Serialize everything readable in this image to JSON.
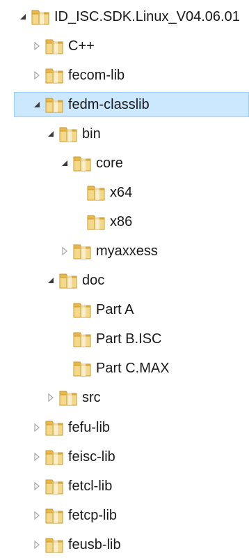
{
  "tree": {
    "items": [
      {
        "label": "ID_ISC.SDK.Linux_V04.06.01",
        "state": "expanded",
        "selected": false
      },
      {
        "label": "C++",
        "state": "collapsed",
        "selected": false
      },
      {
        "label": "fecom-lib",
        "state": "collapsed",
        "selected": false
      },
      {
        "label": "fedm-classlib",
        "state": "expanded",
        "selected": true
      },
      {
        "label": "bin",
        "state": "expanded",
        "selected": false
      },
      {
        "label": "core",
        "state": "expanded",
        "selected": false
      },
      {
        "label": "x64",
        "state": "leaf",
        "selected": false
      },
      {
        "label": "x86",
        "state": "leaf",
        "selected": false
      },
      {
        "label": "myaxxess",
        "state": "collapsed",
        "selected": false
      },
      {
        "label": "doc",
        "state": "expanded",
        "selected": false
      },
      {
        "label": "Part A",
        "state": "leaf",
        "selected": false
      },
      {
        "label": "Part B.ISC",
        "state": "leaf",
        "selected": false
      },
      {
        "label": "Part C.MAX",
        "state": "leaf",
        "selected": false
      },
      {
        "label": "src",
        "state": "collapsed",
        "selected": false
      },
      {
        "label": "fefu-lib",
        "state": "collapsed",
        "selected": false
      },
      {
        "label": "feisc-lib",
        "state": "collapsed",
        "selected": false
      },
      {
        "label": "fetcl-lib",
        "state": "collapsed",
        "selected": false
      },
      {
        "label": "fetcp-lib",
        "state": "collapsed",
        "selected": false
      },
      {
        "label": "feusb-lib",
        "state": "collapsed",
        "selected": false
      }
    ]
  },
  "icons": {
    "folder": "folder-icon",
    "expanded": "expanded-arrow-icon",
    "collapsed": "collapsed-arrow-icon"
  },
  "colors": {
    "selection_fill": "#cce8ff",
    "selection_border": "#99d1ff",
    "folder_light": "#f5d98a",
    "folder_mid": "#e8b94a",
    "folder_dark": "#c99a2e",
    "arrow_expanded": "#3c3c3c",
    "arrow_collapsed": "#a6a6a6"
  }
}
